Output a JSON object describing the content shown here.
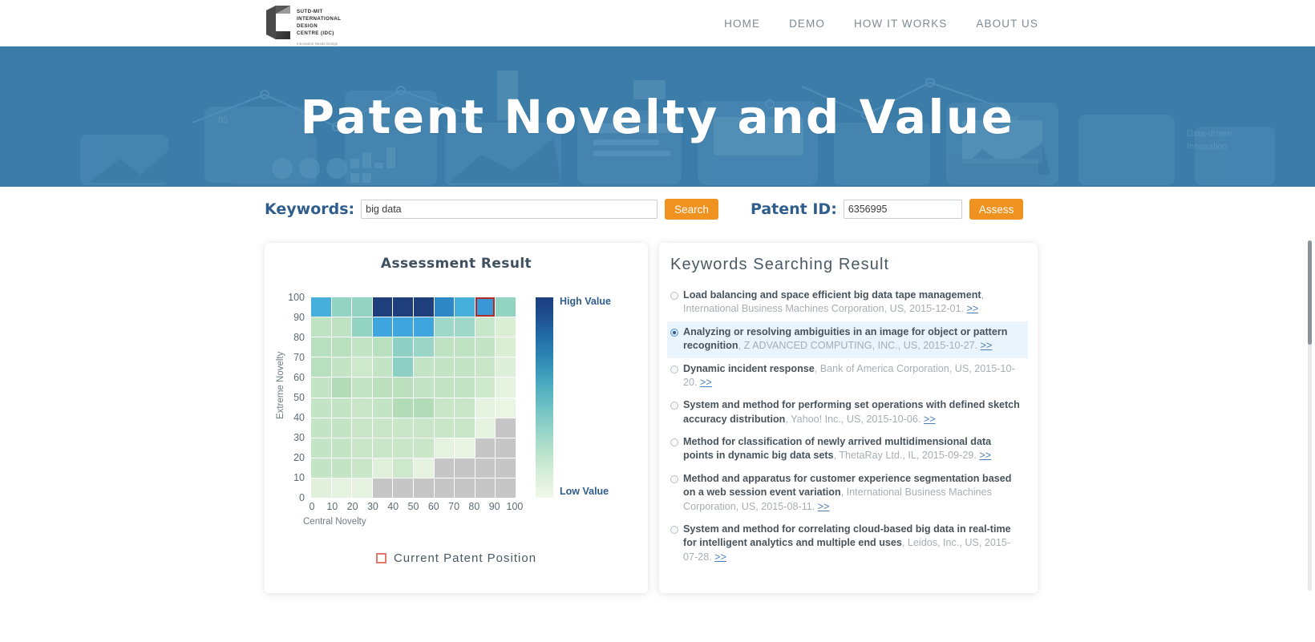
{
  "nav": {
    "logo": {
      "lines": [
        "SUTD-MIT",
        "INTERNATIONAL",
        "DESIGN",
        "CENTRE (IDC)"
      ],
      "tagline": "Innovation Needs Design"
    },
    "links": [
      "HOME",
      "DEMO",
      "HOW IT WORKS",
      "ABOUT US"
    ]
  },
  "hero": {
    "title": "Patent Novelty and Value",
    "bg_color": "#3b7ca8"
  },
  "search": {
    "keywords_label": "Keywords:",
    "keywords_value": "big data",
    "keywords_placeholder": "big data",
    "search_button": "Search",
    "patent_label": "Patent ID:",
    "patent_value": "6356995",
    "patent_placeholder": "6356995",
    "assess_button": "Assess",
    "button_color": "#f0921f"
  },
  "chart_data": {
    "type": "heatmap",
    "title": "Assessment Result",
    "xlabel": "Central Novelty",
    "ylabel": "Extreme Novelty",
    "xticks": [
      "0",
      "10",
      "20",
      "30",
      "40",
      "50",
      "60",
      "70",
      "80",
      "90",
      "100"
    ],
    "yticks": [
      "100",
      "90",
      "80",
      "70",
      "60",
      "50",
      "40",
      "30",
      "20",
      "10",
      "0"
    ],
    "xlim": [
      0,
      100
    ],
    "ylim": [
      0,
      100
    ],
    "colorbar": {
      "high_label": "High Value",
      "low_label": "Low Value"
    },
    "legend": {
      "label": "Current Patent Position",
      "marker_color": "#e2796a"
    },
    "marked_cell": {
      "col": 8,
      "row": 0,
      "x_range": [
        80,
        90
      ],
      "y_range": [
        90,
        100
      ]
    },
    "no_data_color": "#c6c6c6",
    "rows": [
      [
        "#45aedb",
        "#93d3c2",
        "#93d3c2",
        "#1f3f7c",
        "#1f3f7c",
        "#1f3f7c",
        "#2e87c4",
        "#45aedb",
        "#3897d4",
        "#93d3c2"
      ],
      [
        "#bfe3c2",
        "#bfe3c2",
        "#93d3c2",
        "#3ea5de",
        "#3ea5de",
        "#3ea5de",
        "#9fd8c8",
        "#9fd8c8",
        "#c7e6ca",
        "#d9eed5"
      ],
      [
        "#b9e0be",
        "#b9e0be",
        "#c4e4c6",
        "#b9e0be",
        "#8fd0c4",
        "#9ad5c6",
        "#bfe3c2",
        "#bfe3c2",
        "#c4e4c6",
        "#d9eed5"
      ],
      [
        "#b9e0be",
        "#c4e4c6",
        "#cde8cb",
        "#c4e4c6",
        "#8fd0c4",
        "#c4e4c6",
        "#c4e4c6",
        "#c4e4c6",
        "#c9e6c9",
        "#dff0da"
      ],
      [
        "#c4e4c6",
        "#b2dcb8",
        "#c4e4c6",
        "#bcdfbe",
        "#bcdfbe",
        "#c4e4c6",
        "#c4e4c6",
        "#c4e4c6",
        "#cde8cb",
        "#e5f2df"
      ],
      [
        "#c4e4c6",
        "#c4e4c6",
        "#c9e6c9",
        "#c4e4c6",
        "#b2dcb8",
        "#b2dcb8",
        "#c9e6c9",
        "#c9e6c9",
        "#e5f2df",
        "#eaf5e4"
      ],
      [
        "#c4e4c6",
        "#c4e4c6",
        "#c9e6c9",
        "#c9e6c9",
        "#c9e6c9",
        "#c9e6c9",
        "#c9e6c9",
        "#c9e6c9",
        "#e5f2df",
        "#c6c6c6"
      ],
      [
        "#c4e4c6",
        "#c4e4c6",
        "#c9e6c9",
        "#c9e6c9",
        "#c9e6c9",
        "#c9e6c9",
        "#e5f2df",
        "#e9f4e3",
        "#c6c6c6",
        "#c6c6c6"
      ],
      [
        "#c4e4c6",
        "#c4e4c6",
        "#c9e6c9",
        "#e0f0da",
        "#cde8cb",
        "#e5f2df",
        "#c6c6c6",
        "#c6c6c6",
        "#c6c6c6",
        "#c6c6c6"
      ],
      [
        "#e0f0da",
        "#e5f2df",
        "#e5f2df",
        "#c6c6c6",
        "#c6c6c6",
        "#c6c6c6",
        "#c6c6c6",
        "#c6c6c6",
        "#c6c6c6",
        "#c6c6c6"
      ]
    ]
  },
  "results": {
    "title": "Keywords Searching Result",
    "link_text": ">>",
    "items": [
      {
        "selected": false,
        "title": "Load balancing and space efficient big data tape management",
        "meta": ", International Business Machines Corporation, US, 2015-12-01. "
      },
      {
        "selected": true,
        "title": "Analyzing or resolving ambiguities in an image for object or pattern recognition",
        "meta": ", Z ADVANCED COMPUTING, INC., US, 2015-10-27. "
      },
      {
        "selected": false,
        "title": "Dynamic incident response",
        "meta": ", Bank of America Corporation, US, 2015-10-20. "
      },
      {
        "selected": false,
        "title": "System and method for performing set operations with defined sketch accuracy distribution",
        "meta": ", Yahoo! Inc., US, 2015-10-06. "
      },
      {
        "selected": false,
        "title": "Method for classification of newly arrived multidimensional data points in dynamic big data sets",
        "meta": ", ThetaRay Ltd., IL, 2015-09-29. "
      },
      {
        "selected": false,
        "title": "Method and apparatus for customer experience segmentation based on a web session event variation",
        "meta": ", International Business Machines Corporation, US, 2015-08-11. "
      },
      {
        "selected": false,
        "title": "System and method for correlating cloud-based big data in real-time for intelligent analytics and multiple end uses",
        "meta": ", Leidos, Inc., US, 2015-07-28. "
      }
    ]
  }
}
